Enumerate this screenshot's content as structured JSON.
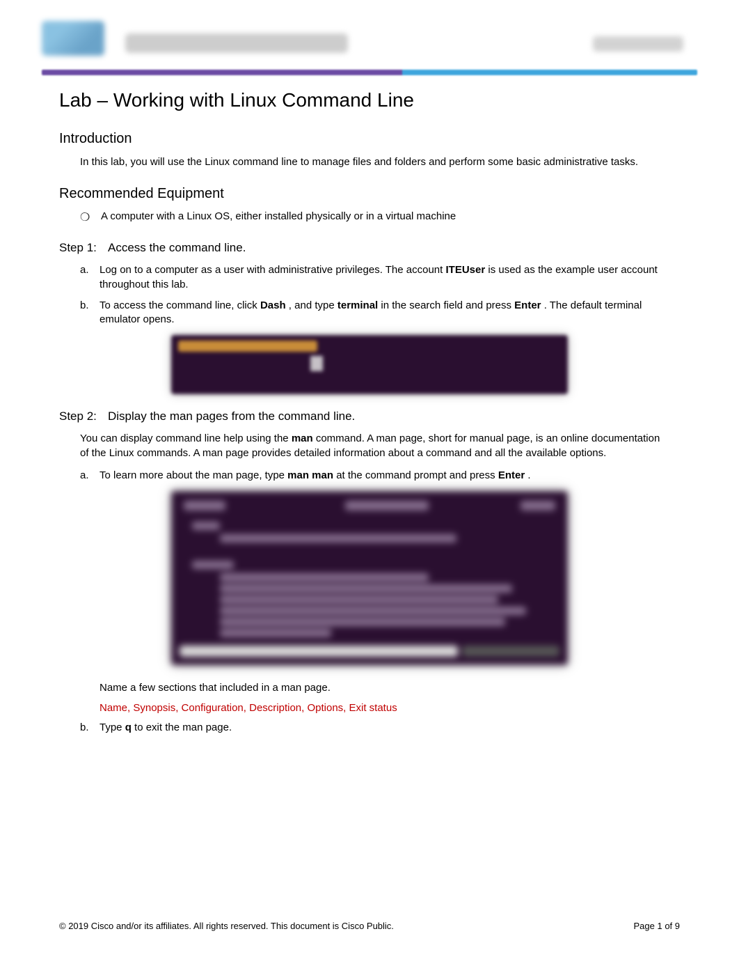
{
  "header": {
    "logo_alt": "cisco-logo",
    "blurred_title": "Cisco Networking Academy",
    "blurred_right": "Mind Wide Open"
  },
  "doc": {
    "title": "Lab – Working with Linux Command Line",
    "intro_heading": "Introduction",
    "intro_text": "In this lab, you will use the Linux command line to manage files and folders and perform some basic administrative tasks.",
    "equip_heading": "Recommended Equipment",
    "equip_bullet": "A computer with a Linux OS, either installed physically or in a virtual machine",
    "step1": {
      "label": "Step 1:",
      "title": "Access the command line.",
      "a_pre": "Log on to a computer as a user with administrative privileges. The account ",
      "a_bold": "ITEUser",
      "a_post": " is used as the example user account throughout this lab.",
      "b_pre": "To access the command line, click ",
      "b_bold1": "Dash",
      "b_mid1": ", and type ",
      "b_bold2": "terminal",
      "b_mid2": " in the search field and press ",
      "b_bold3": "Enter",
      "b_post": ". The default terminal emulator opens."
    },
    "step2": {
      "label": "Step 2:",
      "title": "Display the man pages from the command line.",
      "desc_pre": "You can display command line help using the ",
      "desc_bold": "man",
      "desc_post": " command. A man page, short for manual page, is an online documentation of the Linux commands. A man page provides detailed information about a command and all the available options.",
      "a_pre": "To learn more about the man page, type ",
      "a_bold1": "man man",
      "a_mid": " at the command prompt and press ",
      "a_bold2": "Enter",
      "a_post": ".",
      "question": "Name a few sections that included in a man page.",
      "answer": "Name, Synopsis, Configuration, Description, Options, Exit status",
      "b_pre": "Type ",
      "b_bold": "q",
      "b_post": " to exit the man page."
    }
  },
  "footer": {
    "copyright": "© 2019 Cisco and/or its affiliates. All rights reserved. This document is Cisco Public.",
    "page_pre": "Page ",
    "page_num": "1",
    "page_of": " of 9"
  }
}
